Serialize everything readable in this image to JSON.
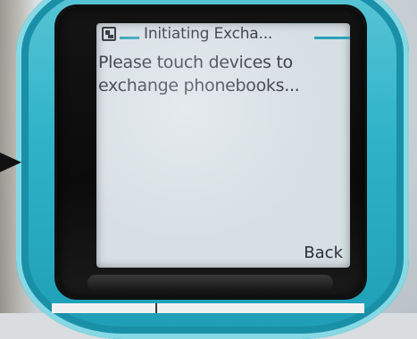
{
  "screen": {
    "title": "Initiating Excha...",
    "message": "Please touch devices to exchange phonebooks...",
    "softkey_right": "Back"
  },
  "colors": {
    "phone_accent": "#2fb3c9",
    "screen_background": "#d6dfe4",
    "screen_text": "#2b2f38"
  },
  "icons": {
    "title_icon": "phonebook-icon",
    "pointer": "arrow-right-icon"
  }
}
